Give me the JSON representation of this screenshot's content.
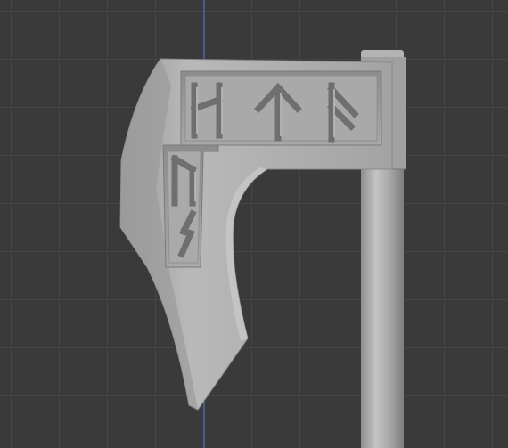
{
  "viewport": {
    "background_color": "#3a3a3a",
    "grid_color": "#464646",
    "axis_color": "#4a7ad8"
  },
  "model": {
    "object": "axe",
    "material_color": "#a9a9a9",
    "runes": [
      "ᚺ",
      "ᛏ",
      "ᚨ",
      "ᚢ",
      "ᛊ"
    ]
  }
}
